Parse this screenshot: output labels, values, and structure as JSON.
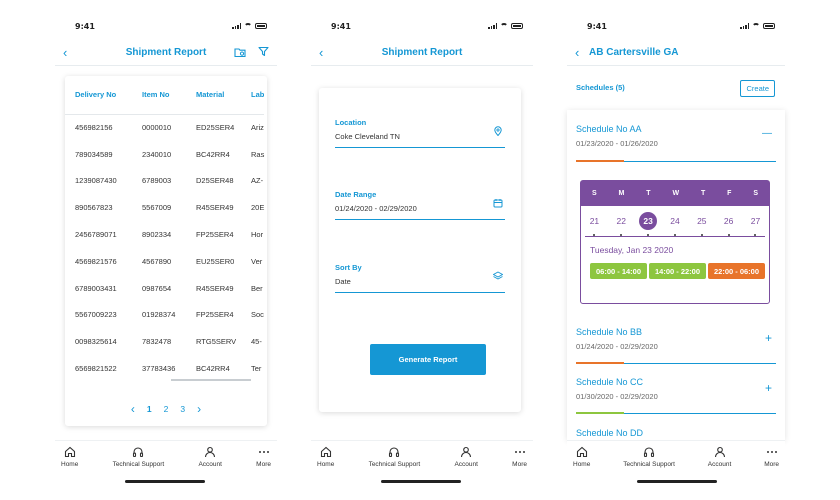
{
  "status": {
    "time": "9:41"
  },
  "screen1": {
    "title": "Shipment Report",
    "columns": [
      "Delivery No",
      "Item No",
      "Material",
      "Lab"
    ],
    "rows": [
      [
        "456982156",
        "0000010",
        "ED25SER4",
        "Ariz"
      ],
      [
        "789034589",
        "2340010",
        "BC42RR4",
        "Ras"
      ],
      [
        "1239087430",
        "6789003",
        "D25SER48",
        "AZ-"
      ],
      [
        "890567823",
        "5567009",
        "R45SER49",
        "20E"
      ],
      [
        "2456789071",
        "8902334",
        "FP25SER4",
        "Hor"
      ],
      [
        "4569821576",
        "4567890",
        "EU25SER0",
        "Ver"
      ],
      [
        "6789003431",
        "0987654",
        "R45SER49",
        "Ber"
      ],
      [
        "5567009223",
        "01928374",
        "FP25SER4",
        "Soc"
      ],
      [
        "0098325614",
        "7832478",
        "RTG5SERV",
        "45-"
      ],
      [
        "6569821522",
        "37783436",
        "BC42RR4",
        "Ter"
      ]
    ],
    "pages": [
      "1",
      "2",
      "3"
    ]
  },
  "screen2": {
    "title": "Shipment Report",
    "location": {
      "label": "Location",
      "value": "Coke Cleveland TN"
    },
    "date_range": {
      "label": "Date Range",
      "value": "01/24/2020 - 02/29/2020"
    },
    "sort_by": {
      "label": "Sort By",
      "value": "Date"
    },
    "button": "Generate Report"
  },
  "screen3": {
    "title": "AB Cartersville GA",
    "schedules_label": "Schedules (5)",
    "create": "Create",
    "items": [
      {
        "name": "Schedule No AA",
        "dates": "01/23/2020 - 01/26/2020",
        "toggle": "—",
        "accent": "#e8742a"
      },
      {
        "name": "Schedule No BB",
        "dates": "01/24/2020 - 02/29/2020",
        "toggle": "+",
        "accent": "#e8742a"
      },
      {
        "name": "Schedule No CC",
        "dates": "01/30/2020 - 02/29/2020",
        "toggle": "+",
        "accent": "#8dc63f"
      },
      {
        "name": "Schedule No DD",
        "dates": "",
        "toggle": "+",
        "accent": "#1597d4"
      }
    ],
    "calendar": {
      "weekdays": [
        "S",
        "M",
        "T",
        "W",
        "T",
        "F",
        "S"
      ],
      "dates": [
        "21",
        "22",
        "23",
        "24",
        "25",
        "26",
        "27"
      ],
      "selected": "23",
      "selected_label": "Tuesday, Jan 23 2020",
      "slots": [
        {
          "label": "06:00 - 14:00",
          "color": "#8dc63f"
        },
        {
          "label": "14:00 - 22:00",
          "color": "#8dc63f"
        },
        {
          "label": "22:00 - 06:00",
          "color": "#e8742a"
        }
      ]
    }
  },
  "tabs": [
    "Home",
    "Technical Support",
    "Account",
    "More"
  ],
  "colors": {
    "accent": "#1597d4",
    "calendar": "#7a4d9e"
  }
}
